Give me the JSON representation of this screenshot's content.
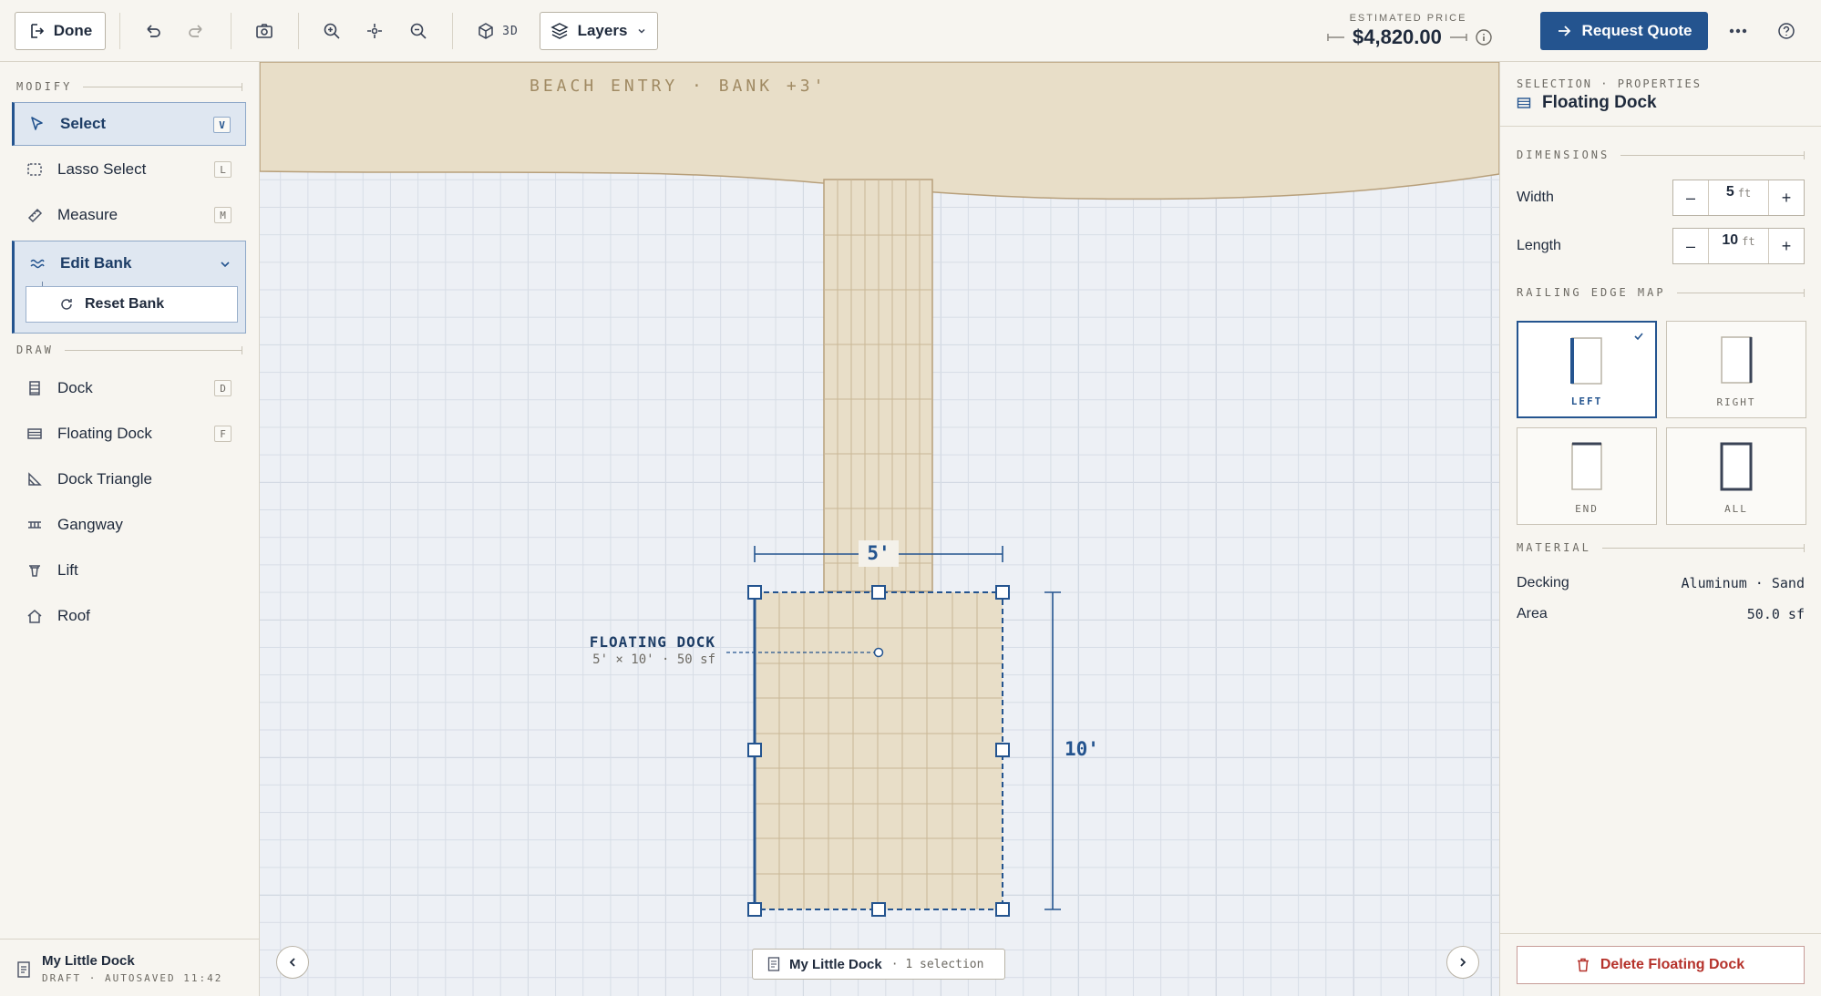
{
  "toolbar": {
    "done_label": "Done",
    "mode_3d_label": "3D",
    "layers_label": "Layers",
    "price_label": "ESTIMATED PRICE",
    "price_value": "$4,820.00",
    "request_quote_label": "Request Quote"
  },
  "sidebar": {
    "modify_header": "MODIFY",
    "draw_header": "DRAW",
    "modify_tools": [
      {
        "label": "Select",
        "key": "V",
        "icon": "cursor-icon"
      },
      {
        "label": "Lasso Select",
        "key": "L",
        "icon": "lasso-icon"
      },
      {
        "label": "Measure",
        "key": "M",
        "icon": "ruler-icon"
      },
      {
        "label": "Edit Bank",
        "icon": "wave-icon"
      }
    ],
    "reset_bank_label": "Reset Bank",
    "draw_tools": [
      {
        "label": "Dock",
        "key": "D",
        "icon": "dock-icon"
      },
      {
        "label": "Floating Dock",
        "key": "F",
        "icon": "floating-dock-icon"
      },
      {
        "label": "Dock Triangle",
        "icon": "triangle-icon"
      },
      {
        "label": "Gangway",
        "icon": "gangway-icon"
      },
      {
        "label": "Lift",
        "icon": "lift-icon"
      },
      {
        "label": "Roof",
        "icon": "roof-icon"
      }
    ],
    "project_name": "My Little Dock",
    "project_status": "DRAFT · AUTOSAVED 11:42"
  },
  "canvas": {
    "bank_label": "BEACH ENTRY · BANK +3'",
    "dock_name": "FLOATING DOCK",
    "dock_dims": "5' × 10' · 50 sf",
    "width_dim": "5'",
    "length_dim": "10'",
    "footer_name": "My Little Dock",
    "footer_selection": "· 1 selection"
  },
  "panel": {
    "header": "SELECTION · PROPERTIES",
    "title": "Floating Dock",
    "dimensions_header": "DIMENSIONS",
    "width_label": "Width",
    "width_value": "5",
    "length_label": "Length",
    "length_value": "10",
    "unit": "ft",
    "railing_header": "RAILING EDGE MAP",
    "railing_options": [
      "LEFT",
      "RIGHT",
      "END",
      "ALL"
    ],
    "railing_selected": "LEFT",
    "material_header": "MATERIAL",
    "decking_label": "Decking",
    "decking_value": "Aluminum · Sand",
    "area_label": "Area",
    "area_value": "50.0 sf",
    "delete_label": "Delete Floating Dock"
  },
  "colors": {
    "accent": "#24548f",
    "sand": "#e8dec8",
    "danger": "#b5322b"
  }
}
